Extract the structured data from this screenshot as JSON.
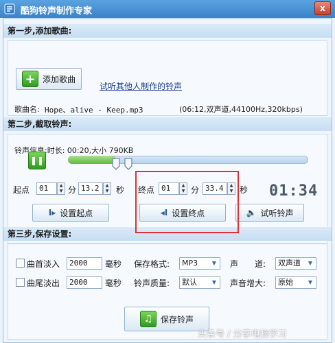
{
  "window": {
    "title": "酷狗铃声制作专家",
    "close_label": "x"
  },
  "step1": {
    "header": "第一步,添加歌曲:",
    "add_button": "添加歌曲",
    "link": "试听其他人制作的铃声",
    "song_label": "歌曲名:",
    "song_name": "Hope、alive - Keep.mp3",
    "song_info": "(06:12,双声道,44100Hz,320kbps)"
  },
  "step2": {
    "header": "第二步,截取铃声:",
    "ringtone_info": "铃声信息:时长: 00:20,大小  790KB",
    "pause_icon": "pause-icon",
    "slider_fraction": 0.2,
    "start_label": "起点",
    "start_min": "01",
    "start_min_unit": "分",
    "start_sec": "13.2",
    "start_sec_unit": "秒",
    "end_label": "终点",
    "end_min": "01",
    "end_min_unit": "分",
    "end_sec": "33.4",
    "end_sec_unit": "秒",
    "time_display": "01:34",
    "set_start_button": "设置起点",
    "set_end_button": "设置终点",
    "preview_button": "试听铃声"
  },
  "step3": {
    "header": "第三步,保存设置:",
    "fade_in_label": "曲首淡入",
    "fade_in_value": "2000",
    "fade_out_label": "曲尾淡出",
    "fade_out_value": "2000",
    "ms_unit": "毫秒",
    "format_label": "保存格式:",
    "format_value": "MP3",
    "channel_label_a": "声",
    "channel_label_b": "道:",
    "channel_value": "双声道",
    "quality_label": "铃声质量:",
    "quality_value": "默认",
    "volume_label": "声音增大:",
    "volume_value": "原始",
    "save_button": "保存铃声"
  },
  "watermark": "头条号 / 分享电脑学习",
  "colors": {
    "accent": "#3b83c7",
    "highlight": "#e03030",
    "green": "#2f9a1d"
  }
}
